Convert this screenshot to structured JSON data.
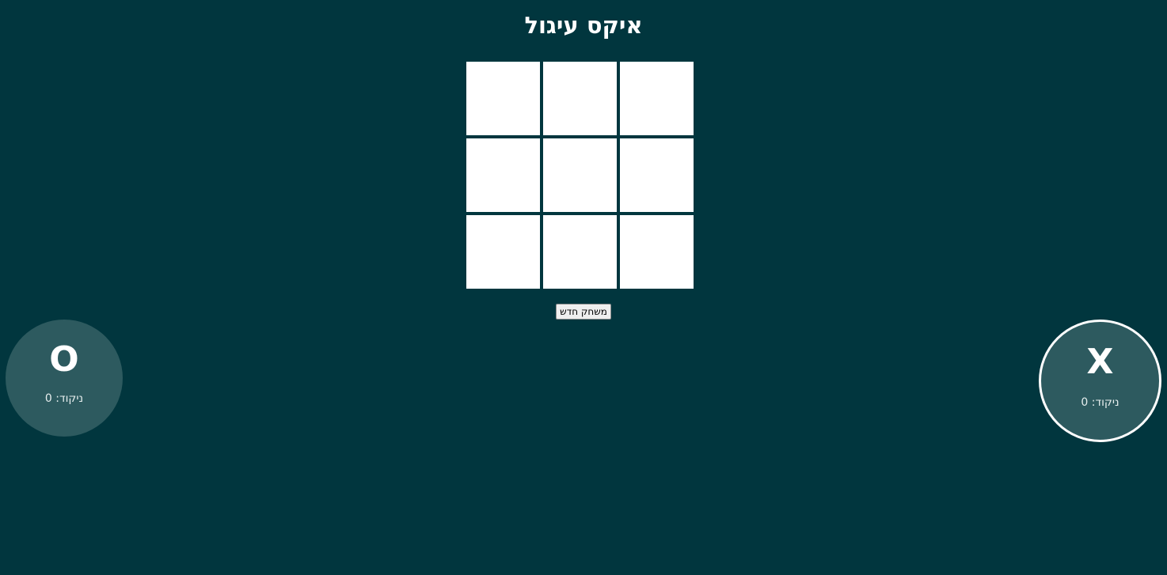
{
  "title": "איקס עיגול",
  "board": {
    "cells": [
      "",
      "",
      "",
      "",
      "",
      "",
      "",
      "",
      ""
    ]
  },
  "reset_label": "משחק חדש",
  "players": {
    "o": {
      "symbol": "O",
      "score_text": "ניקוד: 0",
      "active": false
    },
    "x": {
      "symbol": "X",
      "score_text": "ניקוד: 0",
      "active": true
    }
  },
  "colors": {
    "background": "#01363e",
    "cell": "#ffffff",
    "player_circle": "#2d5a5f",
    "active_border": "#ffffff"
  }
}
